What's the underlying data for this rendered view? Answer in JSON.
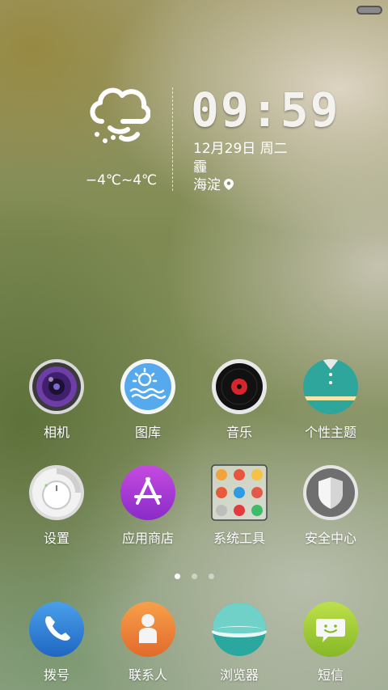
{
  "status_bar": {
    "battery_icon": "battery-icon"
  },
  "weather": {
    "icon": "cloud-haze-icon",
    "temperature": "−4℃~4℃"
  },
  "clock": {
    "time": "09:59",
    "date": "12月29日 周二",
    "condition": "霾",
    "location": "海淀",
    "location_icon": "location-pin-icon"
  },
  "apps": {
    "row1": [
      {
        "label": "相机",
        "icon": "camera-icon"
      },
      {
        "label": "图库",
        "icon": "gallery-icon"
      },
      {
        "label": "音乐",
        "icon": "music-icon"
      },
      {
        "label": "个性主题",
        "icon": "theme-icon"
      }
    ],
    "row2": [
      {
        "label": "设置",
        "icon": "settings-icon"
      },
      {
        "label": "应用商店",
        "icon": "app-store-icon"
      },
      {
        "label": "系统工具",
        "icon": "system-tools-folder-icon"
      },
      {
        "label": "安全中心",
        "icon": "security-center-icon"
      }
    ]
  },
  "page_indicator": {
    "pages": 3,
    "active": 1
  },
  "dock": [
    {
      "label": "拨号",
      "icon": "phone-icon"
    },
    {
      "label": "联系人",
      "icon": "contacts-icon"
    },
    {
      "label": "浏览器",
      "icon": "browser-icon"
    },
    {
      "label": "短信",
      "icon": "messages-icon"
    }
  ]
}
